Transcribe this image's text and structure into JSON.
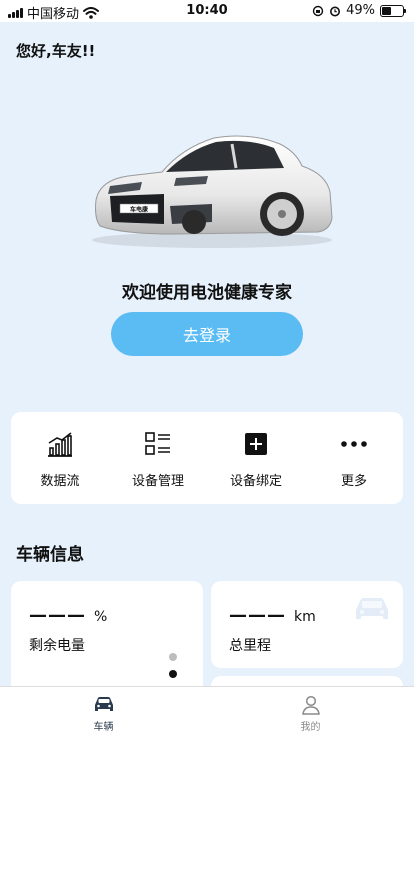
{
  "status_bar": {
    "carrier": "中国移动",
    "time": "10:40",
    "battery": "49%",
    "battery_level": 0.49
  },
  "header": {
    "greeting": "您好,车友!!"
  },
  "hero": {
    "plate_text": "车电康",
    "welcome": "欢迎使用电池健康专家",
    "login_label": "去登录"
  },
  "quick_menu": [
    {
      "label": "数据流",
      "icon": "bar-chart-icon"
    },
    {
      "label": "设备管理",
      "icon": "list-icon"
    },
    {
      "label": "设备绑定",
      "icon": "plus-square-icon"
    },
    {
      "label": "更多",
      "icon": "more-dots-icon"
    }
  ],
  "vehicle_info": {
    "title": "车辆信息",
    "cards": [
      {
        "value": "———",
        "unit": "%",
        "label": "剩余电量"
      },
      {
        "value": "———",
        "unit": "km",
        "label": "总里程"
      }
    ]
  },
  "tabs": [
    {
      "label": "车辆",
      "icon": "car-icon",
      "active": true
    },
    {
      "label": "我的",
      "icon": "person-icon",
      "active": false
    }
  ],
  "colors": {
    "accent": "#5bbcf4",
    "background": "#e6f1fc",
    "tab_active": "#2a3a4e",
    "tab_inactive": "#8a8a8a"
  }
}
